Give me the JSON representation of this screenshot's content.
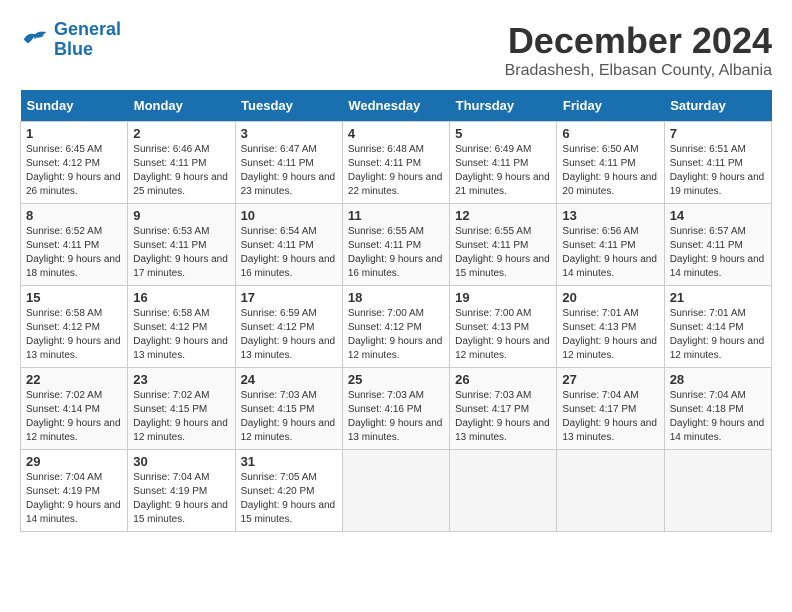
{
  "logo": {
    "line1": "General",
    "line2": "Blue"
  },
  "title": "December 2024",
  "subtitle": "Bradashesh, Elbasan County, Albania",
  "days_of_week": [
    "Sunday",
    "Monday",
    "Tuesday",
    "Wednesday",
    "Thursday",
    "Friday",
    "Saturday"
  ],
  "weeks": [
    [
      {
        "day": "1",
        "sunrise": "6:45 AM",
        "sunset": "4:12 PM",
        "daylight": "9 hours and 26 minutes."
      },
      {
        "day": "2",
        "sunrise": "6:46 AM",
        "sunset": "4:11 PM",
        "daylight": "9 hours and 25 minutes."
      },
      {
        "day": "3",
        "sunrise": "6:47 AM",
        "sunset": "4:11 PM",
        "daylight": "9 hours and 23 minutes."
      },
      {
        "day": "4",
        "sunrise": "6:48 AM",
        "sunset": "4:11 PM",
        "daylight": "9 hours and 22 minutes."
      },
      {
        "day": "5",
        "sunrise": "6:49 AM",
        "sunset": "4:11 PM",
        "daylight": "9 hours and 21 minutes."
      },
      {
        "day": "6",
        "sunrise": "6:50 AM",
        "sunset": "4:11 PM",
        "daylight": "9 hours and 20 minutes."
      },
      {
        "day": "7",
        "sunrise": "6:51 AM",
        "sunset": "4:11 PM",
        "daylight": "9 hours and 19 minutes."
      }
    ],
    [
      {
        "day": "8",
        "sunrise": "6:52 AM",
        "sunset": "4:11 PM",
        "daylight": "9 hours and 18 minutes."
      },
      {
        "day": "9",
        "sunrise": "6:53 AM",
        "sunset": "4:11 PM",
        "daylight": "9 hours and 17 minutes."
      },
      {
        "day": "10",
        "sunrise": "6:54 AM",
        "sunset": "4:11 PM",
        "daylight": "9 hours and 16 minutes."
      },
      {
        "day": "11",
        "sunrise": "6:55 AM",
        "sunset": "4:11 PM",
        "daylight": "9 hours and 16 minutes."
      },
      {
        "day": "12",
        "sunrise": "6:55 AM",
        "sunset": "4:11 PM",
        "daylight": "9 hours and 15 minutes."
      },
      {
        "day": "13",
        "sunrise": "6:56 AM",
        "sunset": "4:11 PM",
        "daylight": "9 hours and 14 minutes."
      },
      {
        "day": "14",
        "sunrise": "6:57 AM",
        "sunset": "4:11 PM",
        "daylight": "9 hours and 14 minutes."
      }
    ],
    [
      {
        "day": "15",
        "sunrise": "6:58 AM",
        "sunset": "4:12 PM",
        "daylight": "9 hours and 13 minutes."
      },
      {
        "day": "16",
        "sunrise": "6:58 AM",
        "sunset": "4:12 PM",
        "daylight": "9 hours and 13 minutes."
      },
      {
        "day": "17",
        "sunrise": "6:59 AM",
        "sunset": "4:12 PM",
        "daylight": "9 hours and 13 minutes."
      },
      {
        "day": "18",
        "sunrise": "7:00 AM",
        "sunset": "4:12 PM",
        "daylight": "9 hours and 12 minutes."
      },
      {
        "day": "19",
        "sunrise": "7:00 AM",
        "sunset": "4:13 PM",
        "daylight": "9 hours and 12 minutes."
      },
      {
        "day": "20",
        "sunrise": "7:01 AM",
        "sunset": "4:13 PM",
        "daylight": "9 hours and 12 minutes."
      },
      {
        "day": "21",
        "sunrise": "7:01 AM",
        "sunset": "4:14 PM",
        "daylight": "9 hours and 12 minutes."
      }
    ],
    [
      {
        "day": "22",
        "sunrise": "7:02 AM",
        "sunset": "4:14 PM",
        "daylight": "9 hours and 12 minutes."
      },
      {
        "day": "23",
        "sunrise": "7:02 AM",
        "sunset": "4:15 PM",
        "daylight": "9 hours and 12 minutes."
      },
      {
        "day": "24",
        "sunrise": "7:03 AM",
        "sunset": "4:15 PM",
        "daylight": "9 hours and 12 minutes."
      },
      {
        "day": "25",
        "sunrise": "7:03 AM",
        "sunset": "4:16 PM",
        "daylight": "9 hours and 13 minutes."
      },
      {
        "day": "26",
        "sunrise": "7:03 AM",
        "sunset": "4:17 PM",
        "daylight": "9 hours and 13 minutes."
      },
      {
        "day": "27",
        "sunrise": "7:04 AM",
        "sunset": "4:17 PM",
        "daylight": "9 hours and 13 minutes."
      },
      {
        "day": "28",
        "sunrise": "7:04 AM",
        "sunset": "4:18 PM",
        "daylight": "9 hours and 14 minutes."
      }
    ],
    [
      {
        "day": "29",
        "sunrise": "7:04 AM",
        "sunset": "4:19 PM",
        "daylight": "9 hours and 14 minutes."
      },
      {
        "day": "30",
        "sunrise": "7:04 AM",
        "sunset": "4:19 PM",
        "daylight": "9 hours and 15 minutes."
      },
      {
        "day": "31",
        "sunrise": "7:05 AM",
        "sunset": "4:20 PM",
        "daylight": "9 hours and 15 minutes."
      },
      null,
      null,
      null,
      null
    ]
  ],
  "labels": {
    "sunrise": "Sunrise:",
    "sunset": "Sunset:",
    "daylight": "Daylight:"
  }
}
